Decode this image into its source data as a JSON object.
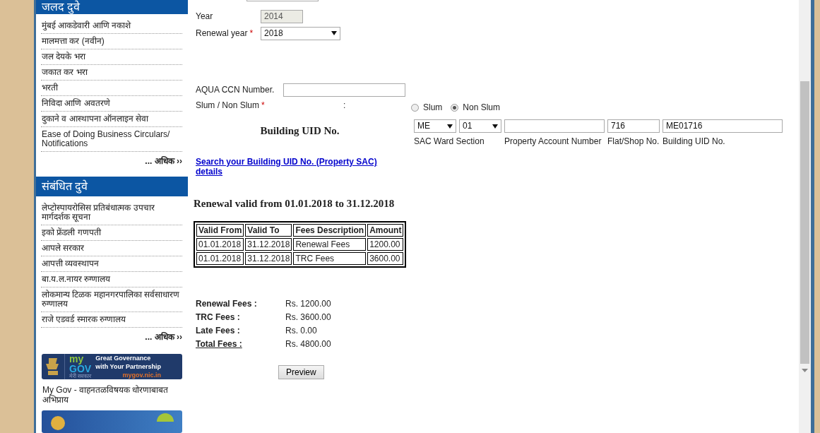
{
  "sidebar": {
    "sections": [
      {
        "title": "जलद दुवे",
        "items": [
          "मुंबई आकडेवारी आणि नकाशे",
          "मालमत्ता कर (नवीन)",
          "जल देयके भरा",
          "जकात कर भरा",
          "भरती",
          "निविदा आणि अवतरणे",
          "दुकाने व आस्थापना ऑनलाइन सेवा",
          "Ease of Doing Business Circulars/ Notifications"
        ],
        "more": "... अधिक ››"
      },
      {
        "title": "संबंधित दुवे",
        "items": [
          "लेप्टोस्पायरोसिस प्रतिबंधात्मक उपचार मार्गदर्शक सूचना",
          "इको फ्रेंडली गणपती",
          "आपले सरकार",
          "आपत्ती व्यवस्थापन",
          "बा.य.ल.नायर रुग्णालय",
          "लोकमान्य टिळक महानगरपालिका सर्वसाधारण रुग्णालय",
          "राजे एडवर्ड स्मारक रुग्णालय"
        ],
        "more": "... अधिक ››"
      }
    ],
    "banner": {
      "logo_top": "my",
      "logo_bottom": "GOV",
      "logo_sub": "मेरी सरकार",
      "tagline_1": "Great Governance",
      "tagline_2": "with Your Partnership",
      "url": "mygov.nic.in"
    },
    "banner_caption": "My Gov - वाहनतळविषयक धोरणाबाबत अभिप्राय"
  },
  "form": {
    "year": {
      "label": "Year",
      "value": "2014",
      "disabled": true
    },
    "renewal_year": {
      "label": "Renewal year",
      "required_mark": "*",
      "value": "2018"
    },
    "aqua_ccn": {
      "label": "AQUA CCN Number."
    },
    "slum": {
      "label": "Slum / Non Slum",
      "required_mark": "*",
      "separator": ":",
      "options": [
        {
          "label": "Slum",
          "selected": false
        },
        {
          "label": "Non Slum",
          "selected": true
        }
      ]
    },
    "building_uid": {
      "title": "Building UID No.",
      "fields": [
        {
          "kind": "select",
          "value": "ME"
        },
        {
          "kind": "select",
          "value": "01"
        },
        {
          "kind": "text"
        },
        {
          "kind": "text",
          "value": "716"
        },
        {
          "kind": "text",
          "value": "ME01716"
        }
      ],
      "captions": [
        "SAC Ward Section",
        "Property Account Number",
        "Flat/Shop No.",
        "Building UID No."
      ]
    },
    "search_link": "Search your Building UID No. (Property SAC) details"
  },
  "validity": "Renewal valid from 01.01.2018 to 31.12.2018",
  "table": {
    "columns": [
      "Valid From",
      "Valid To",
      "Fees Description",
      "Amount"
    ],
    "rows": [
      [
        "01.01.2018",
        "31.12.2018",
        "Renewal Fees",
        "1200.00"
      ],
      [
        "01.01.2018",
        "31.12.2018",
        "TRC Fees",
        "3600.00"
      ]
    ]
  },
  "summary": [
    {
      "kind": "line",
      "label": "Renewal Fees :",
      "value": "Rs. 1200.00"
    },
    {
      "kind": "line",
      "label": "TRC Fees :",
      "value": "Rs. 3600.00"
    },
    {
      "kind": "line",
      "label": "Late Fees :",
      "value": "Rs. 0.00"
    },
    {
      "kind": "total",
      "label": "Total Fees :",
      "value": "Rs. 4800.00"
    }
  ],
  "button": "Preview"
}
